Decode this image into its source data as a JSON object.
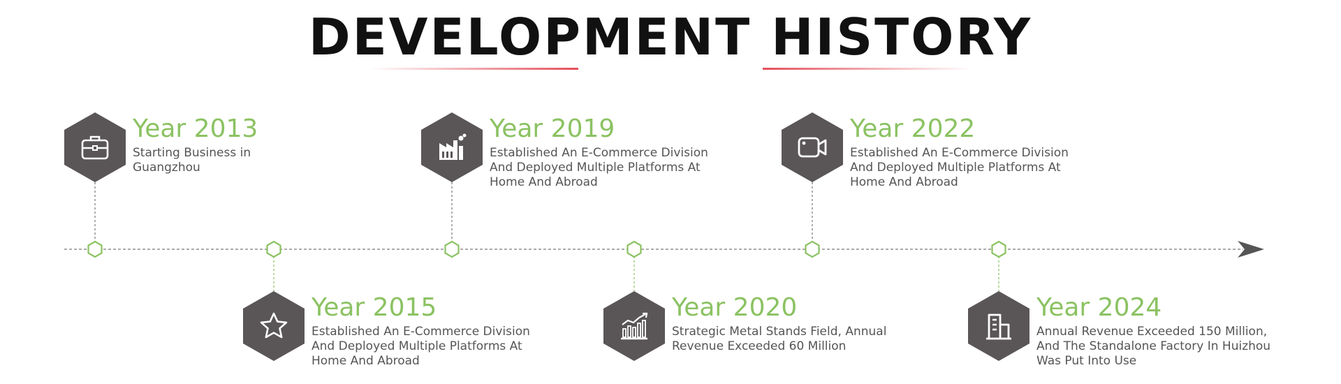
{
  "title": "DEVELOPMENT HISTORY",
  "colors": {
    "accent": "#8bc262",
    "hex_fill": "#5a5657",
    "title": "#111111",
    "underline": "#e2464f",
    "axis": "#555555"
  },
  "events": [
    {
      "year": "Year 2013",
      "desc": [
        "Starting Business in",
        "Guangzhou"
      ],
      "icon": "briefcase-icon",
      "position": "above"
    },
    {
      "year": "Year 2015",
      "desc": [
        "Established An E-Commerce Division",
        "And Deployed Multiple Platforms At",
        "Home And Abroad"
      ],
      "icon": "star-icon",
      "position": "below"
    },
    {
      "year": "Year 2019",
      "desc": [
        "Established An E-Commerce Division",
        "And Deployed Multiple Platforms At",
        "Home And Abroad"
      ],
      "icon": "factory-icon",
      "position": "above"
    },
    {
      "year": "Year 2020",
      "desc": [
        "Strategic Metal Stands Field, Annual",
        "Revenue Exceeded 60 Million"
      ],
      "icon": "growth-chart-icon",
      "position": "below"
    },
    {
      "year": "Year 2022",
      "desc": [
        "Established An E-Commerce Division",
        "And Deployed Multiple Platforms At",
        "Home And Abroad"
      ],
      "icon": "video-camera-icon",
      "position": "above"
    },
    {
      "year": "Year 2024",
      "desc": [
        "Annual Revenue Exceeded 150 Million,",
        " And The Standalone Factory In Huizhou",
        " Was Put Into Use"
      ],
      "icon": "building-icon",
      "position": "below"
    }
  ]
}
